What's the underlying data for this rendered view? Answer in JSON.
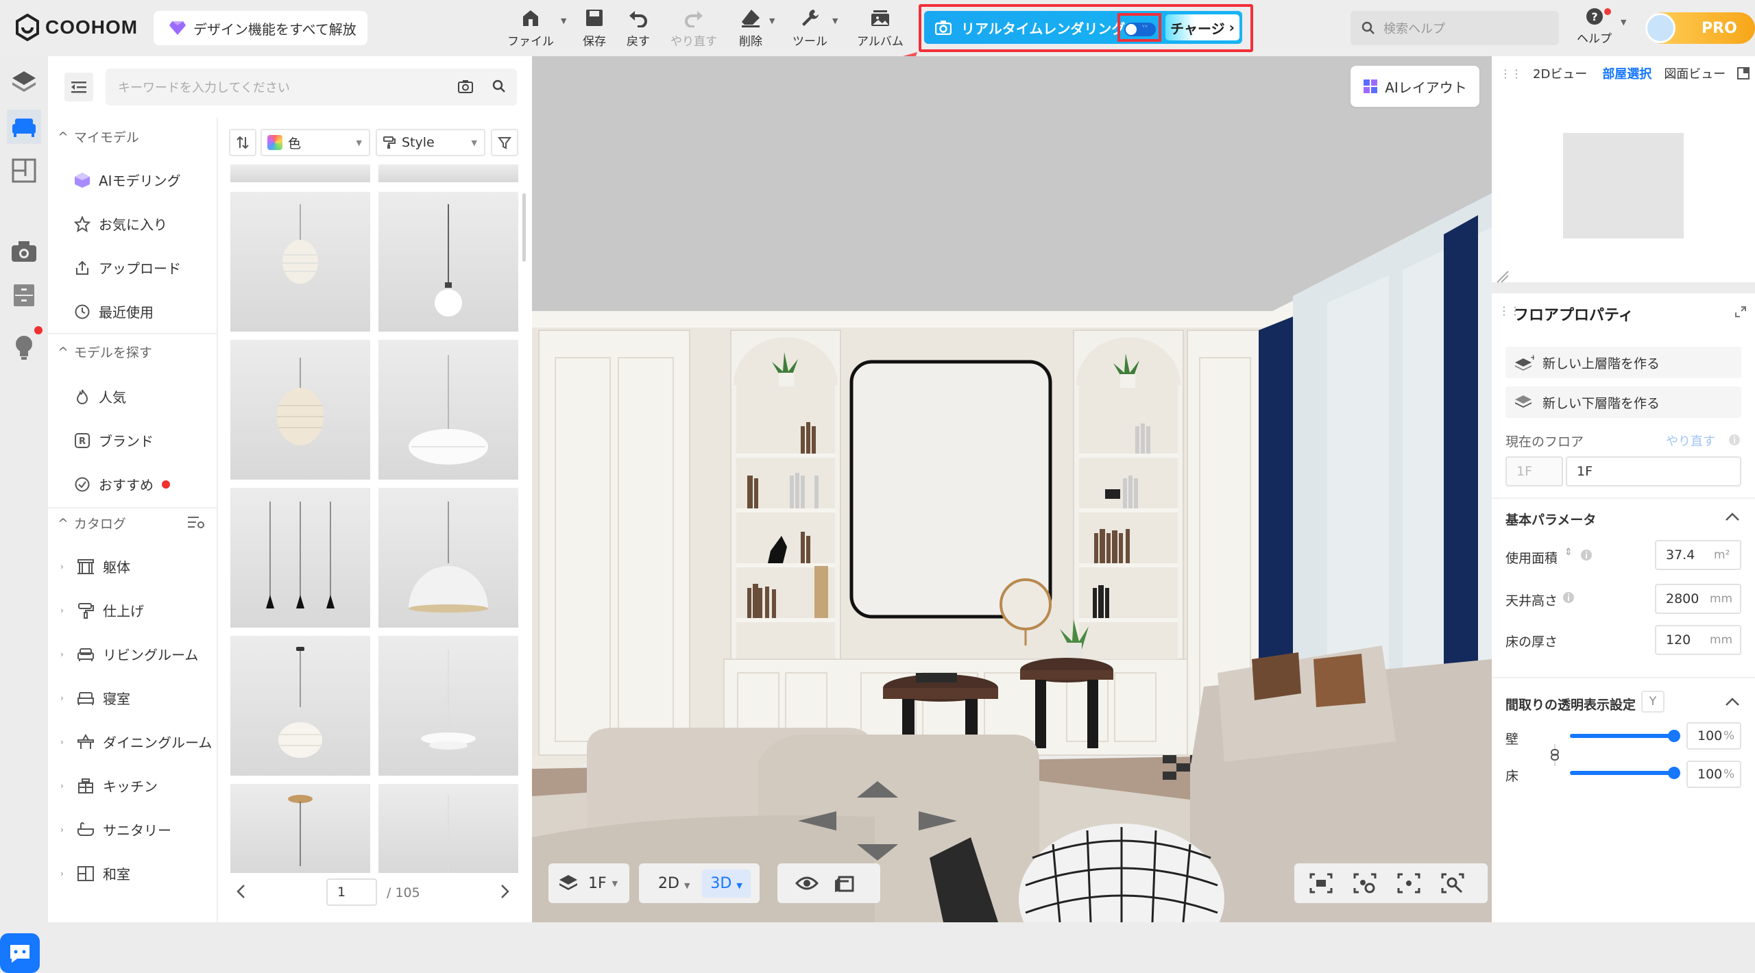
{
  "app": {
    "logo": "COOHOM",
    "unlock_label": "デザイン機能をすべて解放"
  },
  "toolbar": {
    "file": "ファイル",
    "save": "保存",
    "undo": "戻す",
    "redo": "やり直す",
    "delete": "削除",
    "tools": "ツール",
    "album": "アルバム"
  },
  "render": {
    "label": "リアルタイムレンダリング",
    "toggle_on": false,
    "charge_label": "チャージ"
  },
  "search_help": {
    "placeholder": "検索ヘルプ"
  },
  "help": {
    "label": "ヘルプ"
  },
  "pro": {
    "label": "PRO"
  },
  "model_search": {
    "placeholder": "キーワードを入力してください"
  },
  "sidebar": {
    "my_model": {
      "label": "マイモデル",
      "items": [
        "AIモデリング",
        "お気に入り",
        "アップロード",
        "最近使用"
      ]
    },
    "find_model": {
      "label": "モデルを探す",
      "items": [
        "人気",
        "ブランド",
        "おすすめ"
      ]
    },
    "catalog": {
      "label": "カタログ",
      "items": [
        "躯体",
        "仕上げ",
        "リビングルーム",
        "寝室",
        "ダイニングルーム",
        "キッチン",
        "サニタリー",
        "和室"
      ]
    }
  },
  "filters": {
    "color": "色",
    "style": "Style"
  },
  "pagination": {
    "current": "1",
    "total": "/ 105"
  },
  "viewport": {
    "ai_layout": "AIレイアウト",
    "floor": "1F",
    "mode_2d": "2D",
    "mode_3d": "3D"
  },
  "minimap": {
    "tabs": [
      "2Dビュー",
      "部屋選択",
      "図面ビュー"
    ],
    "active_tab": "部屋選択"
  },
  "properties": {
    "title": "フロアプロパティ",
    "new_upper": "新しい上層階を作る",
    "new_lower": "新しい下層階を作る",
    "current_floor_label": "現在のフロア",
    "redo_label": "やり直す",
    "floor_prefix": "1F",
    "floor_name": "1F",
    "basic_params": "基本パラメータ",
    "area_label": "使用面積",
    "area_value": "37.4",
    "area_unit": "m²",
    "ceiling_label": "天井高さ",
    "ceiling_value": "2800",
    "ceiling_unit": "mm",
    "floor_thick_label": "床の厚さ",
    "floor_thick_value": "120",
    "floor_thick_unit": "mm",
    "transparency_label": "間取りの透明表示設定",
    "transparency_key": "Y",
    "wall_label": "壁",
    "wall_value": "100",
    "floor_label": "床",
    "floor_value": "100",
    "percent": "%",
    "wall_opacity": 1.0,
    "floor_opacity": 1.0
  },
  "colors": {
    "accent": "#1677ff",
    "render_blue": "#19a7f2",
    "highlight_red": "#f0303a",
    "pro_gold": "#f7a618"
  }
}
